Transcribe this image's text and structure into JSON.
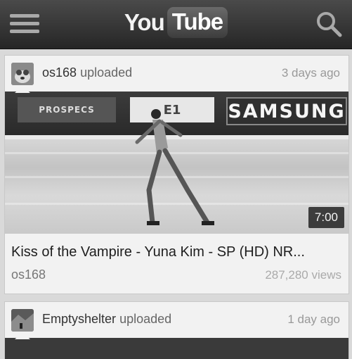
{
  "header": {
    "logo_you": "You",
    "logo_tube": "Tube",
    "menu_icon": "hamburger-menu-icon",
    "search_icon": "search-icon"
  },
  "feed": [
    {
      "uploader": "os168",
      "action": "uploaded",
      "age": "3 days ago",
      "thumbnail": {
        "ads": [
          "PROSPECS",
          "E1",
          "SAMSUNG"
        ],
        "duration": "7:00"
      },
      "title": "Kiss of the Vampire - Yuna Kim - SP (HD) NR...",
      "channel": "os168",
      "views": "287,280 views"
    },
    {
      "uploader": "Emptyshelter",
      "action": "uploaded",
      "age": "1 day ago"
    }
  ]
}
